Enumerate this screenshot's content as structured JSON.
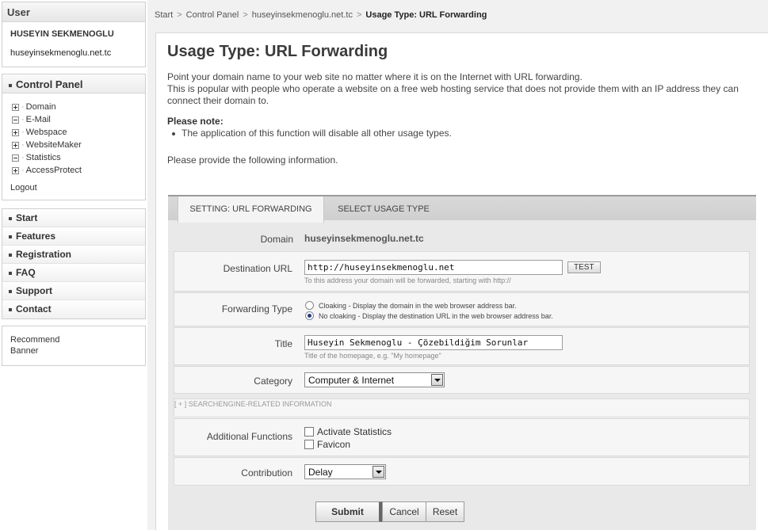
{
  "sidebar": {
    "user": {
      "header": "User",
      "name": "HUSEYIN SEKMENOGLU",
      "domain": "huseyinsekmenoglu.net.tc"
    },
    "control_panel": {
      "header": "Control Panel",
      "items": [
        {
          "label": "Domain",
          "state": "plus"
        },
        {
          "label": "E-Mail",
          "state": "minus"
        },
        {
          "label": "Webspace",
          "state": "plus"
        },
        {
          "label": "WebsiteMaker",
          "state": "plus"
        },
        {
          "label": "Statistics",
          "state": "minus"
        },
        {
          "label": "AccessProtect",
          "state": "plus"
        }
      ],
      "logout": "Logout"
    },
    "nav": [
      {
        "label": "Start"
      },
      {
        "label": "Features"
      },
      {
        "label": "Registration"
      },
      {
        "label": "FAQ"
      },
      {
        "label": "Support"
      },
      {
        "label": "Contact"
      }
    ],
    "extras": [
      "Recommend",
      "Banner"
    ]
  },
  "breadcrumb": {
    "items": [
      "Start",
      "Control Panel",
      "huseyinsekmenoglu.net.tc"
    ],
    "current": "Usage Type: URL Forwarding",
    "separator": ">"
  },
  "main": {
    "title": "Usage Type: URL Forwarding",
    "intro_line1": "Point your domain name to your web site no matter where it is on the Internet with URL forwarding.",
    "intro_line2": "This is popular with people who operate a website on a free web hosting service that does not provide them with an IP address they can connect their domain to.",
    "note_title": "Please note:",
    "note_item": "The application of this function will disable all other usage types.",
    "provide_text": "Please provide the following information."
  },
  "form": {
    "tabs": {
      "active": "SETTING: URL FORWARDING",
      "inactive": "SELECT USAGE TYPE"
    },
    "domain": {
      "label": "Domain",
      "value": "huseyinsekmenoglu.net.tc"
    },
    "destination": {
      "label": "Destination URL",
      "value": "http://huseyinsekmenoglu.net",
      "hint": "To this address your domain will be forwarded, starting with http://",
      "test_label": "TEST"
    },
    "forwarding": {
      "label": "Forwarding Type",
      "option1": "Cloaking - Display the domain in the web browser address bar.",
      "option2": "No cloaking - Display the destination URL in the web browser address bar.",
      "selected": "No cloaking"
    },
    "title_field": {
      "label": "Title",
      "value": "Huseyin Sekmenoglu - Çözebildiğim Sorunlar",
      "hint": "Title of the homepage, e.g. \"My homepage\""
    },
    "category": {
      "label": "Category",
      "value": "Computer & Internet"
    },
    "searchengine_toggle": "[ + ]  SEARCHENGINE-RELATED INFORMATION",
    "additional": {
      "label": "Additional Functions",
      "option1": "Activate Statistics",
      "option2": "Favicon"
    },
    "contribution": {
      "label": "Contribution",
      "value": "Delay"
    },
    "buttons": {
      "submit": "Submit",
      "cancel": "Cancel",
      "reset": "Reset"
    }
  },
  "colors": {
    "radio_selected": "#1a3f88",
    "page_bg": "#f1f1f1",
    "form_bg": "#e9e9e9"
  }
}
